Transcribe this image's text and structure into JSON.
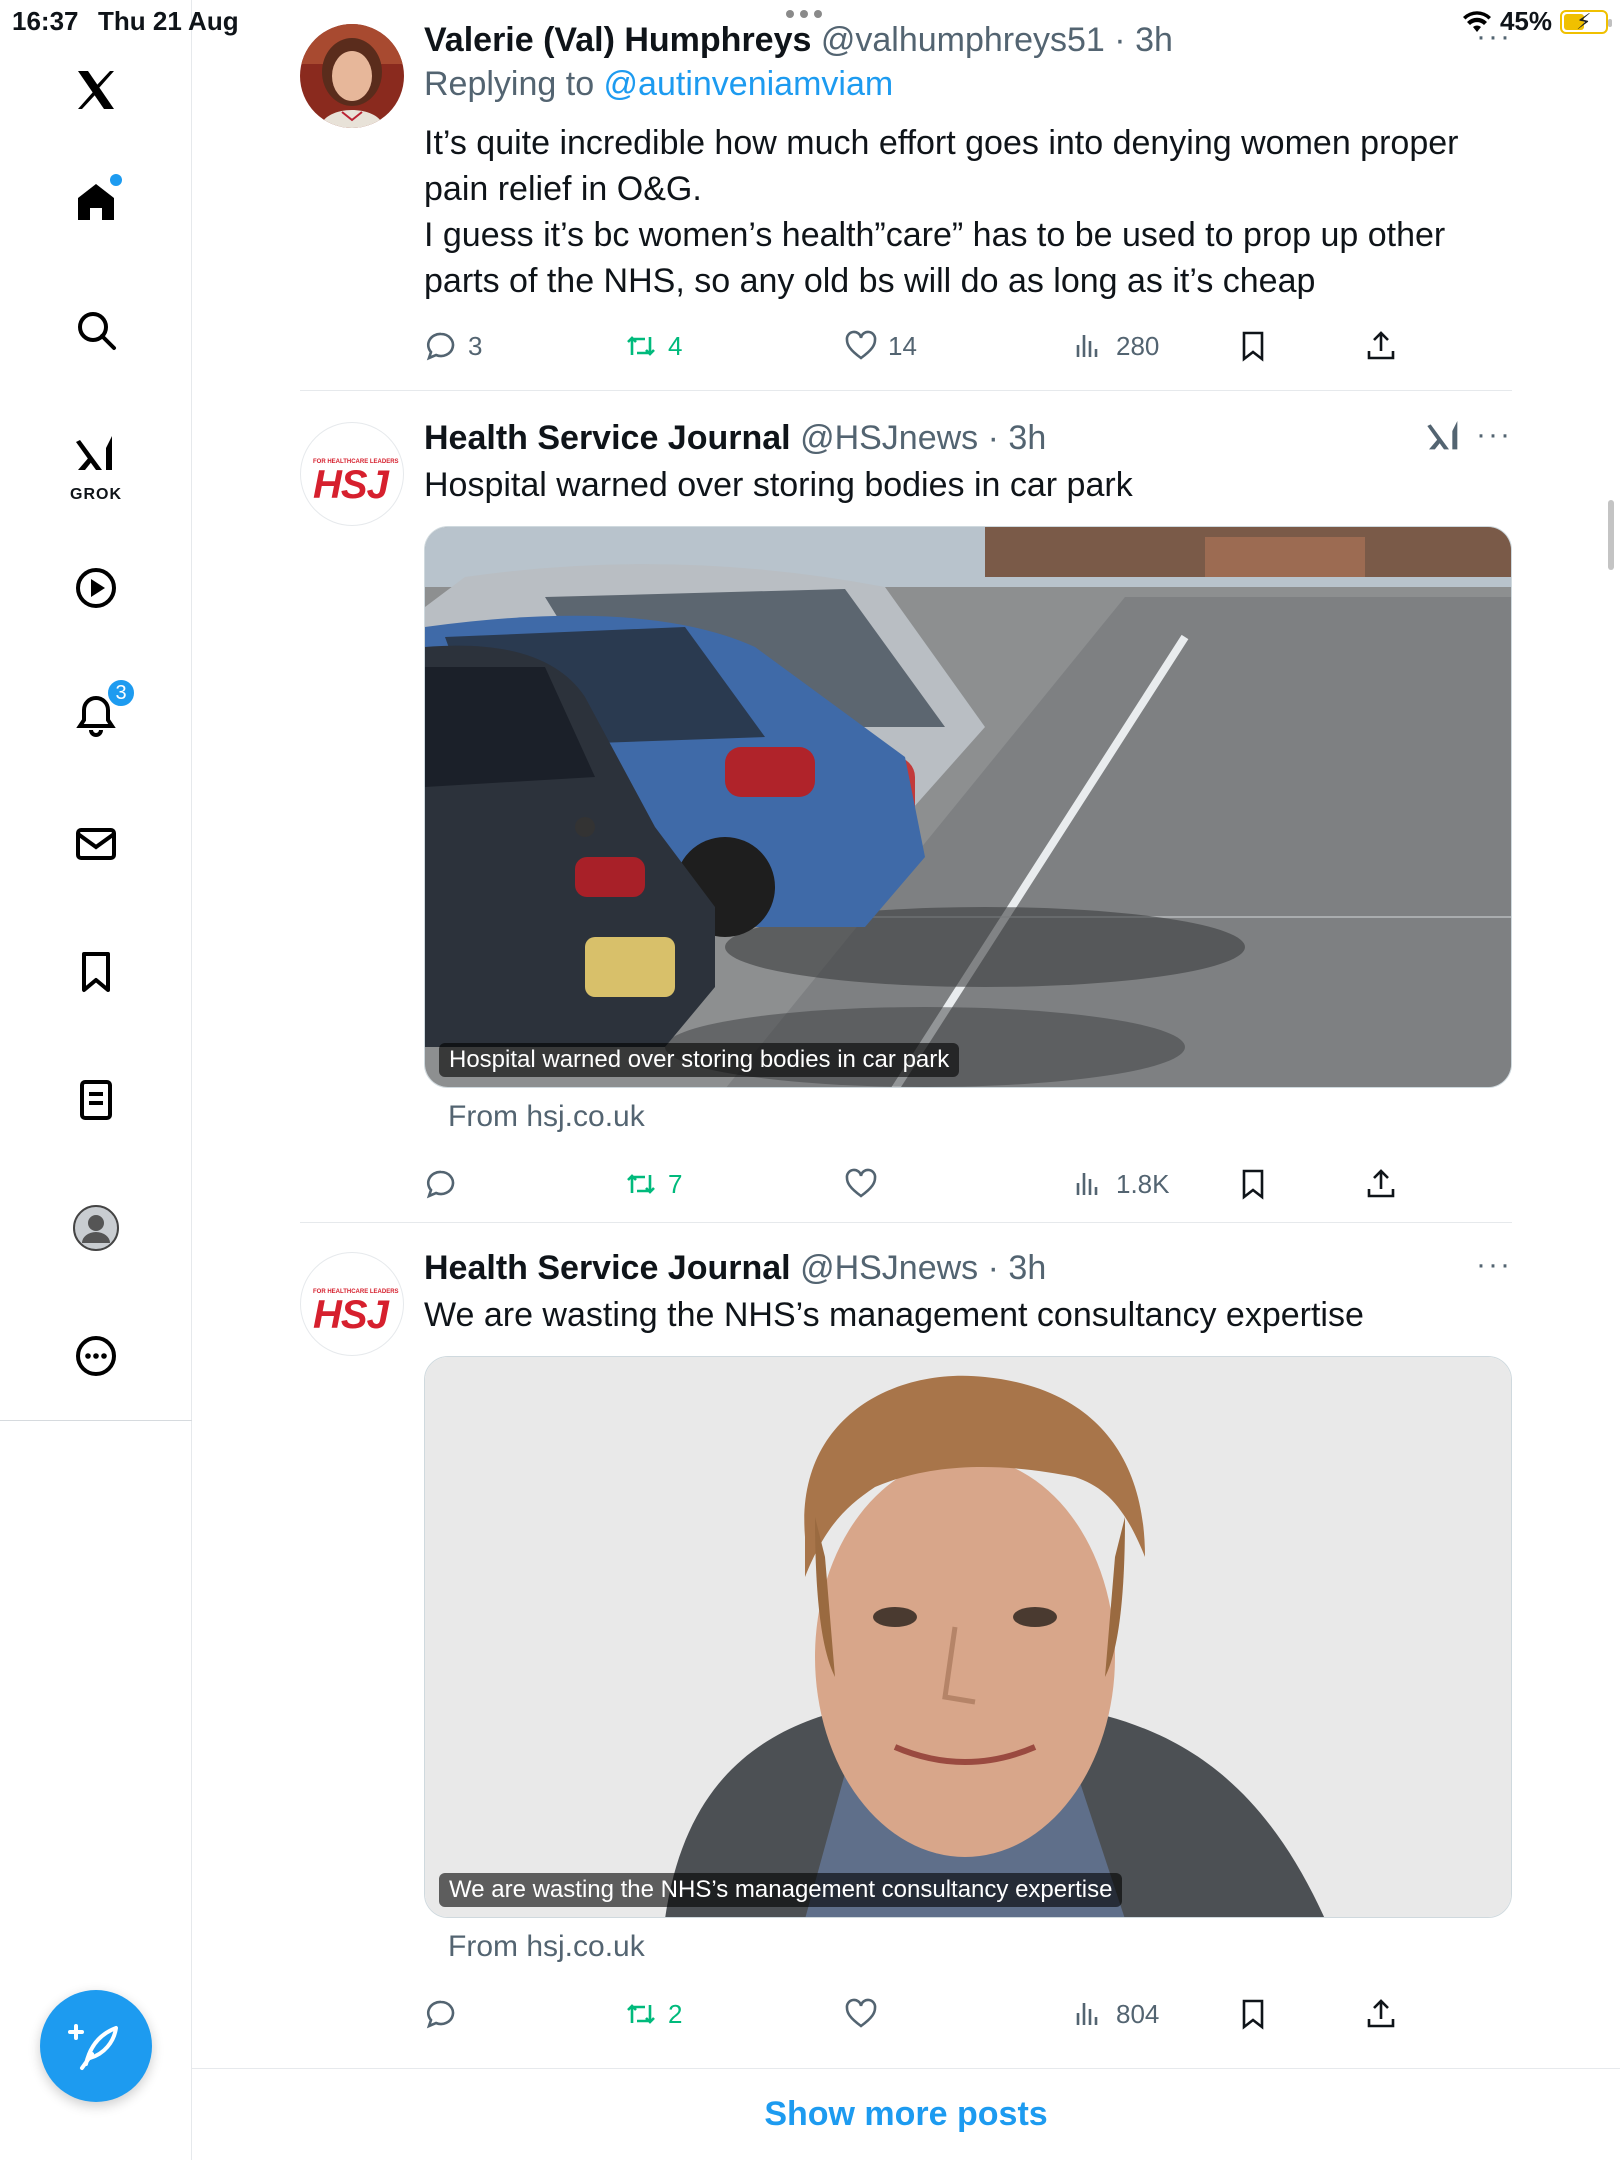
{
  "status_bar": {
    "time": "16:37",
    "date": "Thu 21 Aug",
    "battery": "45%"
  },
  "nav": {
    "items": [
      {
        "name": "x-logo-icon"
      },
      {
        "name": "home-icon"
      },
      {
        "name": "search-icon"
      },
      {
        "name": "grok-icon",
        "label": "GROK"
      },
      {
        "name": "video-icon"
      },
      {
        "name": "notifications-icon",
        "badge": "3"
      },
      {
        "name": "messages-icon"
      },
      {
        "name": "bookmarks-icon"
      },
      {
        "name": "lists-icon"
      },
      {
        "name": "profile-icon"
      },
      {
        "name": "more-icon"
      }
    ],
    "compose": "compose-icon"
  },
  "tweets": [
    {
      "name": "Valerie (Val) Humphreys",
      "handle": "@valhumphreys51",
      "time": "3h",
      "replying_prefix": "Replying to ",
      "replying_to": "@autinveniamviam",
      "lines": [
        "It’s quite incredible how much effort goes into denying women proper",
        "pain relief in O&G.",
        "I guess it’s bc women’s health”care” has to be used to prop up other",
        "parts of the NHS, so any old bs will do as long as it’s cheap"
      ],
      "replies": "3",
      "reposts": "4",
      "likes": "14",
      "views": "280"
    },
    {
      "name": "Health Service Journal",
      "handle": "@HSJnews",
      "time": "3h",
      "text": "Hospital warned over storing bodies in car park",
      "media_caption": "Hospital warned over storing bodies in car park",
      "from": "From hsj.co.uk",
      "replies": "",
      "reposts": "7",
      "likes": "",
      "views": "1.8K"
    },
    {
      "name": "Health Service Journal",
      "handle": "@HSJnews",
      "time": "3h",
      "text": "We are wasting the NHS’s management consultancy expertise",
      "media_caption": "We are wasting the NHS’s management consultancy expertise",
      "from": "From hsj.co.uk",
      "replies": "",
      "reposts": "2",
      "likes": "",
      "views": "804"
    }
  ],
  "hsj_logo": {
    "small": "FOR HEALTHCARE LEADERS",
    "big": "HSJ"
  },
  "show_more": "Show more posts",
  "colors": {
    "accent": "#1d9bf0",
    "repost": "#00ba7c",
    "hsj_red": "#d6202e"
  }
}
